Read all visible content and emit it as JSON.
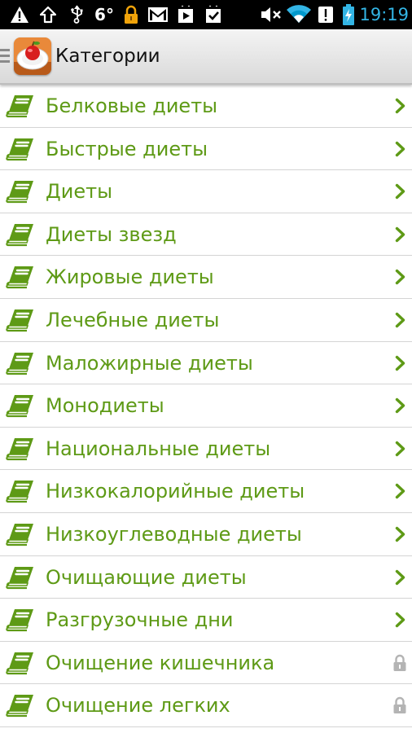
{
  "status_bar": {
    "temperature": "6°",
    "time": "19:19",
    "icons": [
      "warning-icon",
      "upload-icon",
      "usb-icon",
      "lock-icon",
      "gmail-icon",
      "play-store-icon",
      "clipboard-check-icon",
      "mute-icon",
      "wifi-icon",
      "alert-icon",
      "battery-charging-icon"
    ]
  },
  "action_bar": {
    "title": "Категории",
    "app_icon": "apple-plate-icon"
  },
  "colors": {
    "accent_green": "#5e9a16",
    "clock_blue": "#33b5e5",
    "divider": "#d4d4d4",
    "lock_gray": "#b4b4b4"
  },
  "categories": [
    {
      "label": "Белковые диеты",
      "locked": false
    },
    {
      "label": "Быстрые диеты",
      "locked": false
    },
    {
      "label": "Диеты",
      "locked": false
    },
    {
      "label": "Диеты звезд",
      "locked": false
    },
    {
      "label": "Жировые диеты",
      "locked": false
    },
    {
      "label": "Лечебные диеты",
      "locked": false
    },
    {
      "label": "Маложирные диеты",
      "locked": false
    },
    {
      "label": "Монодиеты",
      "locked": false
    },
    {
      "label": "Национальные диеты",
      "locked": false
    },
    {
      "label": "Низкокалорийные диеты",
      "locked": false
    },
    {
      "label": "Низкоуглеводные диеты",
      "locked": false
    },
    {
      "label": "Очищающие диеты",
      "locked": false
    },
    {
      "label": "Разгрузочные дни",
      "locked": false
    },
    {
      "label": "Очищение кишечника",
      "locked": true
    },
    {
      "label": "Очищение легких",
      "locked": true
    }
  ]
}
